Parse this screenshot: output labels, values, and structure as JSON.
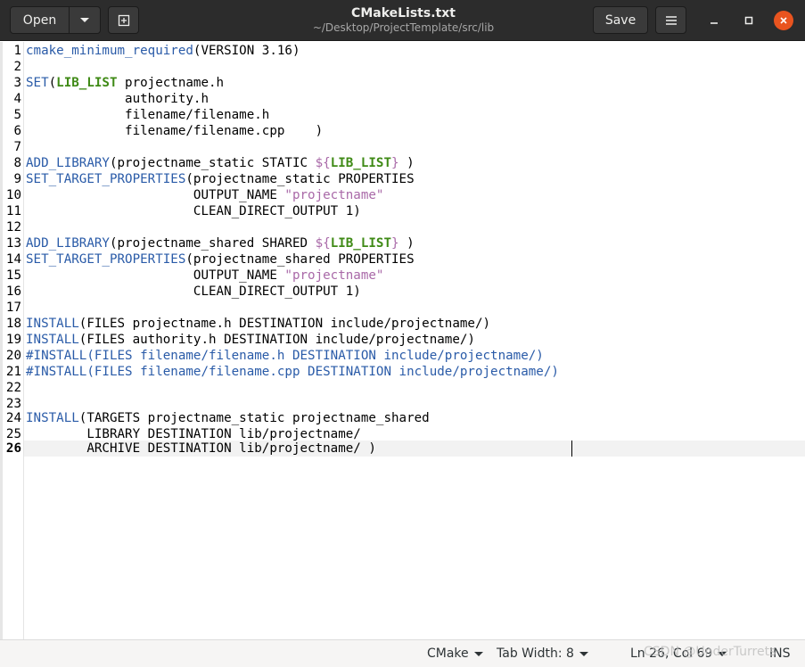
{
  "window": {
    "title": "CMakeLists.txt",
    "subtitle": "~/Desktop/ProjectTemplate/src/lib"
  },
  "toolbar": {
    "open_label": "Open",
    "save_label": "Save"
  },
  "icons": {
    "open_menu": "chevron-down-icon",
    "new_tab": "new-tab-icon",
    "hamburger": "hamburger-menu-icon",
    "minimize": "minimize-icon",
    "maximize": "maximize-icon",
    "close": "close-icon"
  },
  "colors": {
    "accent_close": "#e9541f",
    "keyword": "#2a5ba8",
    "variable": "#3f8a16",
    "string": "#a969a8"
  },
  "editor": {
    "current_line": 26,
    "lines": [
      {
        "n": "1",
        "text": "cmake_minimum_required(VERSION 3.16)"
      },
      {
        "n": "2",
        "text": ""
      },
      {
        "n": "3",
        "text": "SET(LIB_LIST projectname.h"
      },
      {
        "n": "4",
        "text": "             authority.h"
      },
      {
        "n": "5",
        "text": "             filename/filename.h"
      },
      {
        "n": "6",
        "text": "             filename/filename.cpp    )"
      },
      {
        "n": "7",
        "text": ""
      },
      {
        "n": "8",
        "text": "ADD_LIBRARY(projectname_static STATIC ${LIB_LIST} )"
      },
      {
        "n": "9",
        "text": "SET_TARGET_PROPERTIES(projectname_static PROPERTIES"
      },
      {
        "n": "10",
        "text": "                      OUTPUT_NAME \"projectname\""
      },
      {
        "n": "11",
        "text": "                      CLEAN_DIRECT_OUTPUT 1)"
      },
      {
        "n": "12",
        "text": ""
      },
      {
        "n": "13",
        "text": "ADD_LIBRARY(projectname_shared SHARED ${LIB_LIST} )"
      },
      {
        "n": "14",
        "text": "SET_TARGET_PROPERTIES(projectname_shared PROPERTIES"
      },
      {
        "n": "15",
        "text": "                      OUTPUT_NAME \"projectname\""
      },
      {
        "n": "16",
        "text": "                      CLEAN_DIRECT_OUTPUT 1)"
      },
      {
        "n": "17",
        "text": ""
      },
      {
        "n": "18",
        "text": "INSTALL(FILES projectname.h DESTINATION include/projectname/)"
      },
      {
        "n": "19",
        "text": "INSTALL(FILES authority.h DESTINATION include/projectname/)"
      },
      {
        "n": "20",
        "text": "#INSTALL(FILES filename/filename.h DESTINATION include/projectname/)"
      },
      {
        "n": "21",
        "text": "#INSTALL(FILES filename/filename.cpp DESTINATION include/projectname/)"
      },
      {
        "n": "22",
        "text": ""
      },
      {
        "n": "23",
        "text": ""
      },
      {
        "n": "24",
        "text": "INSTALL(TARGETS projectname_static projectname_shared"
      },
      {
        "n": "25",
        "text": "        LIBRARY DESTINATION lib/projectname/"
      },
      {
        "n": "26",
        "text": "        ARCHIVE DESTINATION lib/projectname/ )"
      }
    ]
  },
  "statusbar": {
    "language": "CMake",
    "tab_width": "Tab Width: 8",
    "position": "Ln 26, Col 69",
    "mode": "INS",
    "watermark": "CSDN @UnderTurrets"
  }
}
